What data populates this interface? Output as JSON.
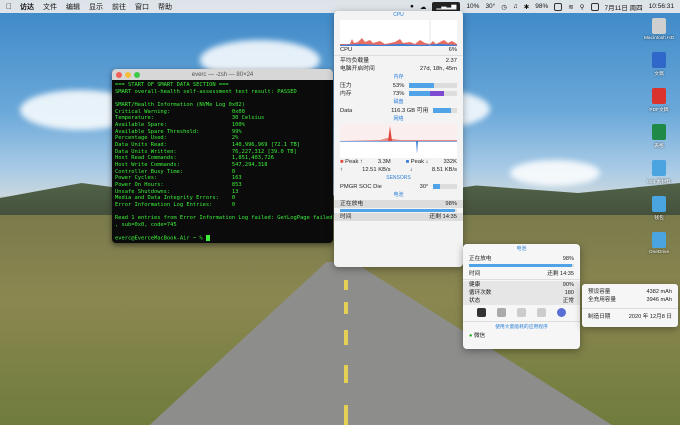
{
  "menubar": {
    "app_name": "访达",
    "menus": [
      "文件",
      "编辑",
      "显示",
      "前往",
      "窗口",
      "帮助"
    ],
    "status": {
      "cpu_percent": "10%",
      "temperature": "30°",
      "battery": "98%",
      "datetime": "7月11日 周四",
      "time": "10:56:31"
    }
  },
  "terminal": {
    "title": "everc — -zsh — 80×24",
    "lines": [
      "=== START OF SMART DATA SECTION ===",
      "SMART overall-health self-assessment test result: PASSED",
      "",
      "SMART/Health Information (NVMe Log 0x02)",
      "Critical Warning:                   0x00",
      "Temperature:                        30 Celsius",
      "Available Spare:                    100%",
      "Available Spare Threshold:          99%",
      "Percentage Used:                    2%",
      "Data Units Read:                    140,996,969 [72.1 TB]",
      "Data Units Written:                 76,227,312 [39.0 TB]",
      "Host Read Commands:                 1,851,403,726",
      "Host Write Commands:                547,294,318",
      "Controller Busy Time:               0",
      "Power Cycles:                       163",
      "Power On Hours:                     853",
      "Unsafe Shutdowns:                   13",
      "Media and Data Integrity Errors:    0",
      "Error Information Log Entries:      0",
      "",
      "Read 1 entries from Error Information Log failed: GetLogPage failed",
      ", sub=0x0, code=745",
      "",
      "everc@EverceMacBook-Air ~ % "
    ]
  },
  "stats_panel": {
    "cpu": {
      "title": "CPU",
      "label": "CPU",
      "value": "6%"
    },
    "load": {
      "label": "平均负载量",
      "value": "2.37"
    },
    "uptime": {
      "label": "电脑开启时间",
      "value": "27d, 18h, 45m"
    },
    "memory": {
      "title": "内存",
      "pressure_label": "压力",
      "pressure_value": "53%",
      "pressure": 0.53,
      "memory_label": "内存",
      "memory_value": "73%",
      "memory": 0.73
    },
    "disk": {
      "title": "磁盘",
      "label": "Data",
      "value": "116.3 GB 可用",
      "used": 0.77
    },
    "network": {
      "title": "网络",
      "peak_up_label": "Peak ↑",
      "peak_up": "3.3M",
      "peak_down_label": "Peak ↓",
      "peak_down": "332K",
      "up_speed": "12.51 KB/s",
      "down_speed": "8.51 KB/s"
    },
    "sensors": {
      "title": "SENSORS",
      "label": "PMGR SOC Die",
      "value": "30°"
    },
    "battery": {
      "title": "电池",
      "status_label": "正在放电",
      "status_value": "98%",
      "level": 0.98,
      "time_label": "时间",
      "time_value": "还剩 14:35"
    }
  },
  "battery_popup": {
    "title": "电池",
    "status_label": "正在放电",
    "status_value": "98%",
    "level": 0.98,
    "time_label": "时间",
    "time_value": "还剩 14:35",
    "health_label": "健康",
    "health_value": "90%",
    "health": 0.9,
    "cycles_label": "循环次数",
    "cycles_value": "180",
    "state_label": "状态",
    "state_value": "正常",
    "apps_text": "使用大量能耗的应用程序",
    "wechat": "微信"
  },
  "capacity_popup": {
    "design_label": "预设容量",
    "design_value": "4382 mAh",
    "full_label": "全充用容量",
    "full_value": "3946 mAh",
    "date_label": "制造日期",
    "date_value": "2020 年 12月8 日"
  },
  "desktop_icons": [
    {
      "label": "Macintosh HD",
      "color": "#cfcfcf"
    },
    {
      "label": "文稿",
      "color": "#2f68c8"
    },
    {
      "label": "PDF文稿",
      "color": "#d9332b"
    },
    {
      "label": "表格",
      "color": "#1f8a47"
    },
    {
      "label": "024 素材料",
      "color": "#4aa4e0"
    },
    {
      "label": "钱包",
      "color": "#4aa4e0"
    },
    {
      "label": "OneDrive",
      "color": "#4aa4e0"
    }
  ],
  "colors": {
    "terminal_text": "#3cf03a",
    "accent": "#2a7fd9",
    "bar_blue": "#4fa3e6",
    "bar_purple": "#7c4bd1",
    "net_up": "#e0483d",
    "net_down": "#3b7fdb"
  }
}
